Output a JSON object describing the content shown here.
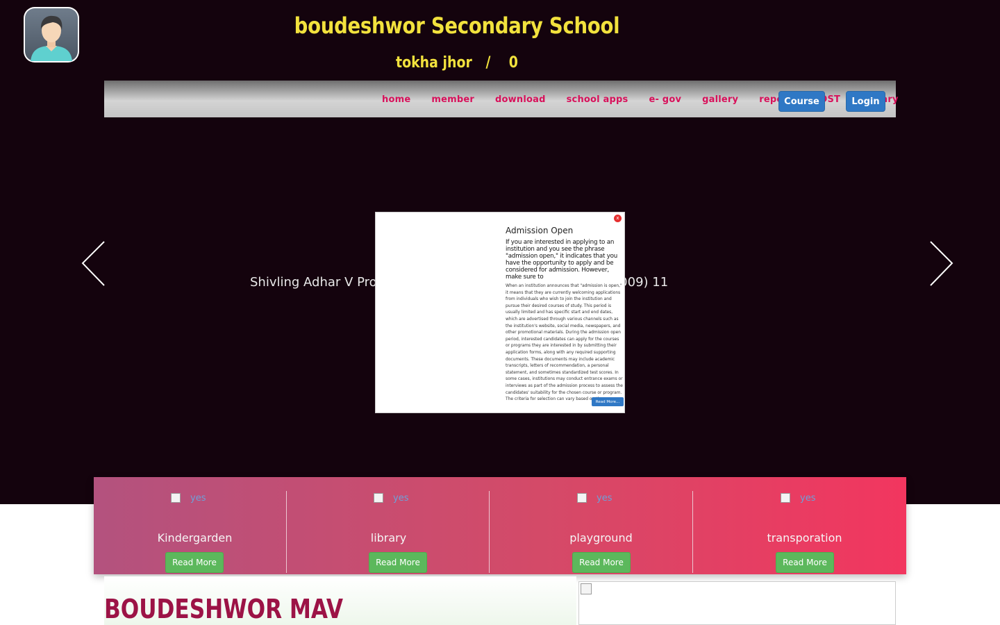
{
  "header": {
    "title": "boudeshwor Secondary School",
    "address": "tokha jhor   /    0"
  },
  "nav": {
    "items": [
      "home",
      "member",
      "download",
      "school apps",
      "e- gov",
      "gallery",
      "report",
      "POST",
      "Library"
    ],
    "course_label": "Course",
    "login_label": "Login"
  },
  "slider": {
    "caption": "Shivling Adhar V Pro                                        Nagarpalika (009) 11"
  },
  "modal": {
    "close_label": "x",
    "title": "Admission Open",
    "intro": "If you are interested in applying to an institution and you see the phrase \"admission open,\" it indicates that you have the opportunity to apply and be considered for admission. However, make sure to",
    "body": "When an institution announces that \"admission is open,\" it means that they are currently welcoming applications from individuals who wish to join the institution and pursue their desired courses of study. This period is usually limited and has specific start and end dates, which are advertised through various channels such as the institution's website, social media, newspapers, and other promotional materials. During the admission open period, interested candidates can apply for the courses or programs they are interested in by submitting their application forms, along with any required supporting documents. These documents may include academic transcripts, letters of recommendation, a personal statement, and sometimes standardized test scores. In some cases, institutions may conduct entrance exams or interviews as part of the admission process to assess the candidates' suitability for the chosen course or program. The criteria for selection can vary based on the institution, the lev",
    "read_more_label": "Read More..."
  },
  "features": [
    {
      "title": "Kindergarden",
      "img_alt": "yes",
      "button": "Read More"
    },
    {
      "title": "library",
      "img_alt": "yes",
      "button": "Read More"
    },
    {
      "title": "playground",
      "img_alt": "yes",
      "button": "Read More"
    },
    {
      "title": "transporation",
      "img_alt": "yes",
      "button": "Read More"
    }
  ],
  "about": {
    "heading": "BOUDESHWOR MAV"
  },
  "colors": {
    "hero_bg": "#14030d",
    "title": "#f2e23d",
    "nav_link": "#d8105a",
    "button_blue": "#2f78c5",
    "button_green": "#5cb85c",
    "heading": "#9c1346"
  },
  "icons": {
    "logo": "user-avatar-icon",
    "prev": "chevron-left-icon",
    "next": "chevron-right-icon"
  }
}
